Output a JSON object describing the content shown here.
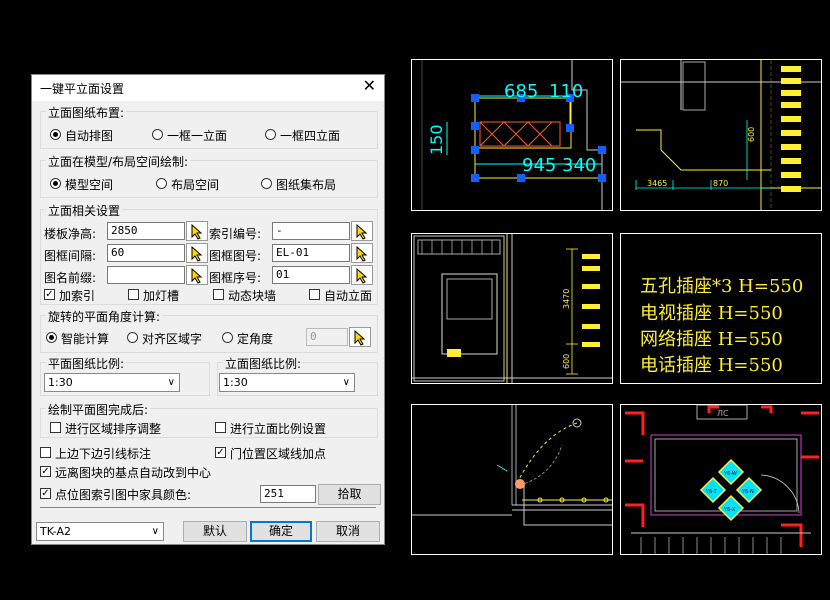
{
  "dialog": {
    "title": "一键平立面设置",
    "close": "✕",
    "layout": {
      "label": "立面图纸布置:",
      "options": [
        "自动排图",
        "一框一立面",
        "一框四立面"
      ],
      "selected": 0
    },
    "space": {
      "label": "立面在模型/布局空间绘制:",
      "options": [
        "模型空间",
        "布局空间",
        "图纸集布局"
      ],
      "selected": 0
    },
    "settings": {
      "label": "立面相关设置",
      "floor_height_label": "楼板净高:",
      "floor_height_value": "2850",
      "index_no_label": "索引编号:",
      "index_no_value": "-",
      "frame_gap_label": "图框间隔:",
      "frame_gap_value": "60",
      "frame_no_label": "图框图号:",
      "frame_no_value": "EL-01",
      "name_prefix_label": "图名前缀:",
      "name_prefix_value": "",
      "frame_seq_label": "图框序号:",
      "frame_seq_value": "01",
      "checks": [
        {
          "label": "加索引",
          "checked": true
        },
        {
          "label": "加灯槽",
          "checked": false
        },
        {
          "label": "动态块墙",
          "checked": false
        },
        {
          "label": "自动立面",
          "checked": false
        }
      ]
    },
    "rotation": {
      "label": "旋转的平面角度计算:",
      "options": [
        "智能计算",
        "对齐区域字",
        "定角度"
      ],
      "selected": 0,
      "angle_value": "0"
    },
    "plan_scale": {
      "label": "平面图纸比例:",
      "value": "1:30"
    },
    "elev_scale": {
      "label": "立面图纸比例:",
      "value": "1:30"
    },
    "after": {
      "label": "绘制平面图完成后:",
      "checks": [
        {
          "label": "进行区域排序调整",
          "checked": false
        },
        {
          "label": "进行立面比例设置",
          "checked": false
        }
      ]
    },
    "misc": [
      {
        "label": "上边下边引线标注",
        "checked": false
      },
      {
        "label": "门位置区域线加点",
        "checked": true
      },
      {
        "label": "远离图块的基点自动改到中心",
        "checked": true
      },
      {
        "label": "点位图索引图中家具颜色:",
        "checked": true
      }
    ],
    "color_value": "251",
    "pick_button": "拾取",
    "template": "TK-A2",
    "default_button": "默认",
    "ok_button": "确定",
    "cancel_button": "取消"
  },
  "drawings": {
    "dims_p1": [
      "685",
      "110",
      "150",
      "945",
      "340"
    ],
    "dims_p2": [
      "600",
      "3465",
      "870"
    ],
    "dims_p3": [
      "3470",
      "600"
    ],
    "notes": [
      "五孔插座*3 H=550",
      "电视插座 H=550",
      "网络插座 H=550",
      "电话插座 H=550"
    ],
    "tag_p6": "ЛС",
    "socket_tags": [
      "Y6-W",
      "Y6-T",
      "Y6-N",
      "Y6-X"
    ]
  },
  "colors": {
    "cad_bg": "#000000",
    "cyan": "#00ffff",
    "yellow": "#ffee33",
    "red": "#ff2020",
    "grip": "#1060ff",
    "accent": "#0078d7"
  }
}
